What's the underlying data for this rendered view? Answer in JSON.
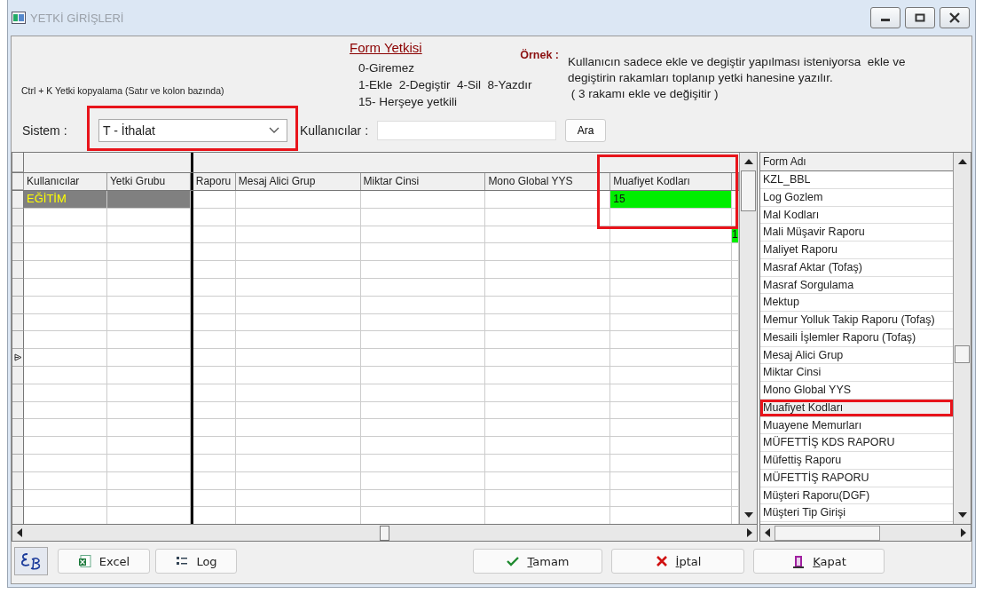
{
  "window": {
    "title": "YETKİ GİRİŞLERİ"
  },
  "header": {
    "copy_hint": "Ctrl + K Yetki kopyalama (Satır ve kolon bazında)",
    "form_title": "Form Yetkisi",
    "codes": [
      "0-Giremez",
      "1-Ekle  2-Degiştir  4-Sil  8-Yazdır",
      "15- Herşeye yetkili"
    ],
    "example_label": "Örnek :",
    "example_lines": [
      "Kullanıcın sadece ekle ve degiştir yapılması isteniyorsa  ekle ve",
      "degiştirin rakamları toplanıp yetki hanesine yazılır.",
      " ( 3 rakamı ekle ve değişitir )"
    ]
  },
  "filters": {
    "system_label": "Sistem :",
    "system_value": "T - İthalat",
    "system_highlighted": true,
    "users_label": "Kullanıcılar :",
    "search_button": "Ara"
  },
  "grid": {
    "columns": [
      {
        "label": "Kullanıcılar",
        "highlighted": false
      },
      {
        "label": "Yetki Grubu",
        "highlighted": false
      },
      {
        "label": "Raporu",
        "highlighted": false
      },
      {
        "label": "Mesaj Alici Grup",
        "highlighted": false
      },
      {
        "label": "Miktar Cinsi",
        "highlighted": false
      },
      {
        "label": "Mono Global YYS",
        "highlighted": false
      },
      {
        "label": "Muafiyet Kodları",
        "highlighted": true
      }
    ],
    "rows": [
      {
        "selected": true,
        "current": false,
        "kullanicilar": "EĞİTİM",
        "muafiyet_kodlari": "15"
      },
      {
        "selected": false,
        "current": false
      },
      {
        "selected": false,
        "current": false,
        "column_8": "1"
      },
      {
        "selected": false,
        "current": false
      },
      {
        "selected": false,
        "current": false
      },
      {
        "selected": false,
        "current": false
      },
      {
        "selected": false,
        "current": false
      },
      {
        "selected": false,
        "current": false
      },
      {
        "selected": false,
        "current": false
      },
      {
        "selected": false,
        "current": true
      },
      {
        "selected": false,
        "current": false
      },
      {
        "selected": false,
        "current": false
      },
      {
        "selected": false,
        "current": false
      },
      {
        "selected": false,
        "current": false
      },
      {
        "selected": false,
        "current": false
      },
      {
        "selected": false,
        "current": false
      },
      {
        "selected": false,
        "current": false
      },
      {
        "selected": false,
        "current": false
      },
      {
        "selected": false,
        "current": false
      }
    ]
  },
  "form_list": {
    "header": "Form Adı",
    "items": [
      {
        "label": "KZL_BBL",
        "selected": false,
        "highlighted": false
      },
      {
        "label": "Log Gozlem",
        "selected": false,
        "highlighted": false
      },
      {
        "label": "Mal Kodları",
        "selected": false,
        "highlighted": false
      },
      {
        "label": "Mali Müşavir Raporu",
        "selected": false,
        "highlighted": false
      },
      {
        "label": "Maliyet Raporu",
        "selected": false,
        "highlighted": false
      },
      {
        "label": "Masraf Aktar (Tofaş)",
        "selected": false,
        "highlighted": false
      },
      {
        "label": "Masraf Sorgulama",
        "selected": false,
        "highlighted": false
      },
      {
        "label": "Mektup",
        "selected": false,
        "highlighted": false
      },
      {
        "label": "Memur Yolluk Takip Raporu (Tofaş)",
        "selected": false,
        "highlighted": false
      },
      {
        "label": "Mesaili İşlemler Raporu (Tofaş)",
        "selected": false,
        "highlighted": false
      },
      {
        "label": "Mesaj Alici Grup",
        "selected": false,
        "highlighted": false
      },
      {
        "label": "Miktar Cinsi",
        "selected": false,
        "highlighted": false
      },
      {
        "label": "Mono Global YYS",
        "selected": false,
        "highlighted": false
      },
      {
        "label": "Muafiyet Kodları",
        "selected": true,
        "highlighted": true
      },
      {
        "label": "Muayene Memurları",
        "selected": false,
        "highlighted": false
      },
      {
        "label": "MÜFETTİŞ KDS RAPORU",
        "selected": false,
        "highlighted": false
      },
      {
        "label": "Müfettiş Raporu",
        "selected": false,
        "highlighted": false
      },
      {
        "label": "MÜFETTİŞ RAPORU",
        "selected": false,
        "highlighted": false
      },
      {
        "label": "Müşteri Raporu(DGF)",
        "selected": false,
        "highlighted": false
      },
      {
        "label": "Müşteri Tip Girişi",
        "selected": false,
        "highlighted": false
      }
    ]
  },
  "buttons": [
    {
      "kind": "excel",
      "label": "Excel"
    },
    {
      "kind": "log",
      "label": "Log"
    },
    {
      "kind": "ok",
      "label": "Tamam"
    },
    {
      "kind": "cancel",
      "label": "İptal"
    },
    {
      "kind": "close",
      "label": "Kapat"
    }
  ]
}
